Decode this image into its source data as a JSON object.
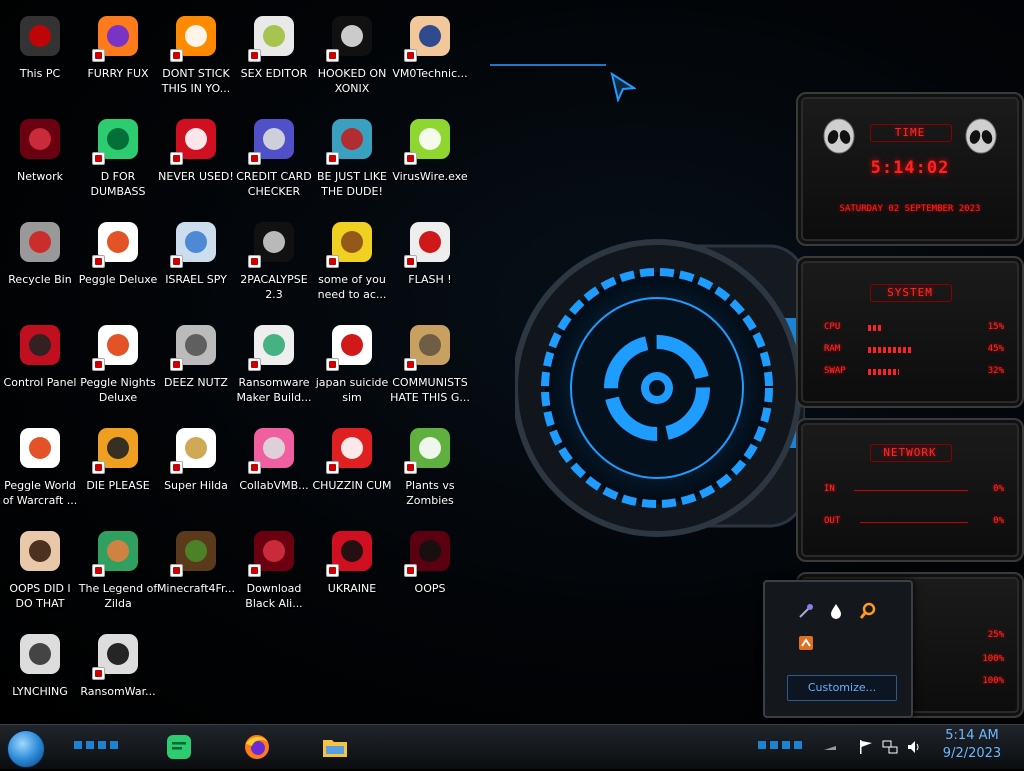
{
  "desktop": {
    "icons": [
      {
        "label": "This PC",
        "icon": "pc-icon"
      },
      {
        "label": "FURRY FUX",
        "icon": "firefox-icon"
      },
      {
        "label": "DONT STICK THIS IN YO...",
        "icon": "vlc-cone-icon"
      },
      {
        "label": "SEX EDITOR",
        "icon": "hex-editor-icon"
      },
      {
        "label": "HOOKED ON XONIX",
        "icon": "xonix-icon"
      },
      {
        "label": "VM0Technic...",
        "icon": "doctor-icon"
      },
      {
        "label": "Network",
        "icon": "alien-globe-icon"
      },
      {
        "label": "D FOR DUMBASS",
        "icon": "green-chat-icon"
      },
      {
        "label": "NEVER USED!",
        "icon": "dev-badge-icon"
      },
      {
        "label": "CREDIT CARD CHECKER",
        "icon": "credit-card-icon"
      },
      {
        "label": "BE JUST LIKE THE DUDE!",
        "icon": "elf-icon"
      },
      {
        "label": "VirusWire.exe",
        "icon": "lime-icon"
      },
      {
        "label": "Recycle Bin",
        "icon": "recycle-bin-icon"
      },
      {
        "label": "Peggle Deluxe",
        "icon": "peggle-icon"
      },
      {
        "label": "ISRAEL SPY",
        "icon": "network-spy-icon"
      },
      {
        "label": "2PACALYPSE 2.3",
        "icon": "terminal-icon"
      },
      {
        "label": "some of you need to ac...",
        "icon": "dog-icon"
      },
      {
        "label": "FLASH !",
        "icon": "flash-icon"
      },
      {
        "label": "Control Panel",
        "icon": "control-panel-icon"
      },
      {
        "label": "Peggle Nights Deluxe",
        "icon": "peggle-icon"
      },
      {
        "label": "DEEZ NUTZ",
        "icon": "stacked-windows-icon"
      },
      {
        "label": "Ransomware Maker Build...",
        "icon": "app-window-icon"
      },
      {
        "label": "japan suicide sim",
        "icon": "document-icon"
      },
      {
        "label": "COMMUNISTS HATE THIS G...",
        "icon": "money-bag-icon"
      },
      {
        "label": "Peggle World of Warcraft ...",
        "icon": "peggle-icon"
      },
      {
        "label": "DIE PLEASE",
        "icon": "de-icon"
      },
      {
        "label": "Super Hilda",
        "icon": "pixel-cat-icon"
      },
      {
        "label": "CollabVMB...",
        "icon": "screen-icon"
      },
      {
        "label": "CHUZZIN CUM",
        "icon": "chuzzle-icon"
      },
      {
        "label": "Plants vs Zombies",
        "icon": "plant-icon"
      },
      {
        "label": "OOPS DID I DO THAT",
        "icon": "portrait-icon"
      },
      {
        "label": "The Legend of Zilda",
        "icon": "pixel-hero-icon"
      },
      {
        "label": "Minecraft4Fr...",
        "icon": "grass-block-icon"
      },
      {
        "label": "Download Black Ali...",
        "icon": "alien-globe-icon"
      },
      {
        "label": "UKRAINE",
        "icon": "radiation-icon"
      },
      {
        "label": "OOPS",
        "icon": "alien-pc-icon"
      },
      {
        "label": "LYNCHING",
        "icon": "lynch-icon"
      },
      {
        "label": "RansomWar...",
        "icon": "skull-icon"
      }
    ]
  },
  "gadgets": {
    "time": {
      "title": "TIME",
      "value": "5:14:02",
      "date": "SATURDAY 02 SEPTEMBER 2023"
    },
    "system": {
      "title": "SYSTEM",
      "rows": [
        {
          "name": "CPU",
          "value": "15%",
          "level": 0.15
        },
        {
          "name": "RAM",
          "value": "45%",
          "level": 0.45
        },
        {
          "name": "SWAP",
          "value": "32%",
          "level": 0.32
        }
      ]
    },
    "network": {
      "title": "NETWORK",
      "rows": [
        {
          "name": "IN",
          "value": "0%"
        },
        {
          "name": "OUT",
          "value": "0%"
        }
      ]
    },
    "drives": {
      "rows": [
        "25%",
        "100%",
        "100%"
      ]
    }
  },
  "tray_popup": {
    "customize_label": "Customize..."
  },
  "taskbar": {
    "clock_time": "5:14 AM",
    "clock_date": "9/2/2023",
    "pinned": [
      "green-chat-icon",
      "firefox-icon",
      "file-explorer-icon"
    ]
  },
  "colors": {
    "accent": "#ff2222",
    "blue_glow": "#1e9cff",
    "clock": "#6ab8ff"
  }
}
